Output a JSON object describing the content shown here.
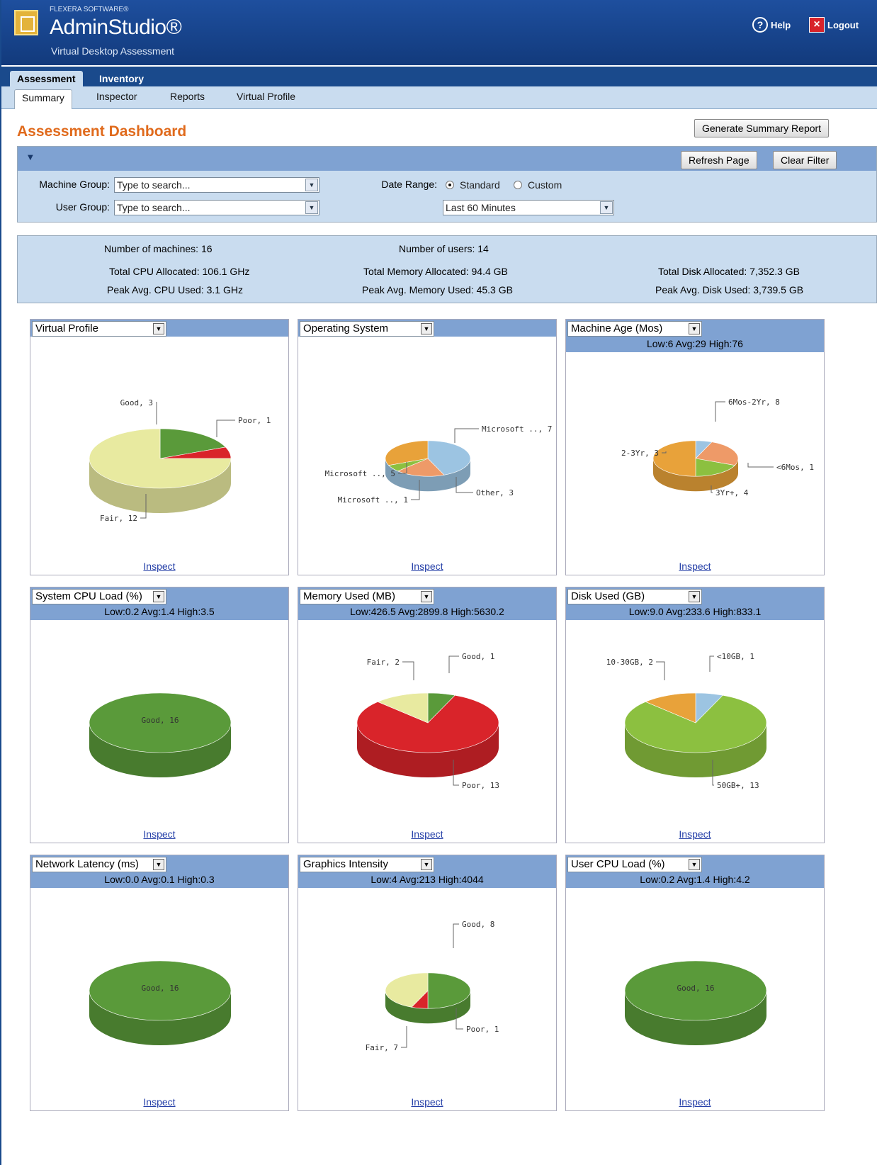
{
  "header": {
    "vendor": "FLEXERA SOFTWARE®",
    "product": "AdminStudio®",
    "subtitle": "Virtual Desktop Assessment",
    "help_label": "Help",
    "logout_label": "Logout"
  },
  "tabs": [
    {
      "label": "Assessment"
    },
    {
      "label": "Inventory"
    }
  ],
  "subtabs": [
    {
      "label": "Summary"
    },
    {
      "label": "Inspector"
    },
    {
      "label": "Reports"
    },
    {
      "label": "Virtual Profile"
    }
  ],
  "page": {
    "title": "Assessment Dashboard",
    "generate_button": "Generate Summary Report"
  },
  "filter": {
    "refresh_button": "Refresh Page",
    "clear_button": "Clear Filter",
    "machine_group_label": "Machine Group:",
    "machine_group_value": "Type to search...",
    "user_group_label": "User Group:",
    "user_group_value": "Type to search...",
    "date_range_label": "Date Range:",
    "standard_label": "Standard",
    "custom_label": "Custom",
    "date_range_value": "Last 60 Minutes"
  },
  "stats": {
    "machines": "Number of machines: 16",
    "users": "Number of users: 14",
    "cpu_alloc": "Total CPU Allocated: 106.1 GHz",
    "mem_alloc": "Total Memory Allocated: 94.4 GB",
    "disk_alloc": "Total Disk Allocated: 7,352.3 GB",
    "cpu_used": "Peak Avg. CPU Used: 3.1 GHz",
    "mem_used": "Peak Avg. Memory Used: 45.3 GB",
    "disk_used": "Peak Avg. Disk Used: 3,739.5 GB"
  },
  "colors": {
    "good": "#5a9a3a",
    "poor": "#d9242a",
    "fair": "#e8eaa0",
    "orange": "#e8a23a",
    "blue": "#9cc4e2",
    "salmon": "#ee9a68",
    "lightgreen": "#8cc040",
    "accent": "#e06a1c",
    "bar": "#7fa2d2"
  },
  "panels": [
    {
      "title": "Virtual Profile",
      "stats": "",
      "inspect": "Inspect"
    },
    {
      "title": "Operating System",
      "stats": "",
      "inspect": "Inspect"
    },
    {
      "title": "Machine Age (Mos)",
      "stats": "Low:6 Avg:29 High:76",
      "inspect": "Inspect"
    },
    {
      "title": "System CPU Load (%)",
      "stats": "Low:0.2 Avg:1.4 High:3.5",
      "inspect": "Inspect"
    },
    {
      "title": "Memory Used (MB)",
      "stats": "Low:426.5 Avg:2899.8 High:5630.2",
      "inspect": "Inspect"
    },
    {
      "title": "Disk Used (GB)",
      "stats": "Low:9.0 Avg:233.6 High:833.1",
      "inspect": "Inspect"
    },
    {
      "title": "Network Latency (ms)",
      "stats": "Low:0.0 Avg:0.1 High:0.3",
      "inspect": "Inspect"
    },
    {
      "title": "Graphics Intensity",
      "stats": "Low:4 Avg:213 High:4044",
      "inspect": "Inspect"
    },
    {
      "title": "User CPU Load (%)",
      "stats": "Low:0.2 Avg:1.4 High:4.2",
      "inspect": "Inspect"
    }
  ],
  "chart_data": [
    {
      "type": "pie",
      "title": "Virtual Profile",
      "categories": [
        "Good",
        "Poor",
        "Fair"
      ],
      "values": [
        3,
        1,
        12
      ],
      "labels": [
        "Good, 3",
        "Poor, 1",
        "Fair, 12"
      ],
      "colors": [
        "#5a9a3a",
        "#d9242a",
        "#e8eaa0"
      ]
    },
    {
      "type": "pie",
      "title": "Operating System",
      "categories": [
        "Microsoft ..",
        "Other",
        "Microsoft ..",
        "Microsoft .."
      ],
      "values": [
        7,
        3,
        1,
        5
      ],
      "labels": [
        "Microsoft .., 7",
        "Other, 3",
        "Microsoft .., 1",
        "Microsoft .., 5"
      ],
      "colors": [
        "#9cc4e2",
        "#ee9a68",
        "#8cc040",
        "#e8a23a"
      ]
    },
    {
      "type": "pie",
      "title": "Machine Age (Mos)",
      "categories": [
        "<6Mos",
        "3Yr+",
        "2-3Yr",
        "6Mos-2Yr"
      ],
      "values": [
        1,
        4,
        3,
        8
      ],
      "labels": [
        "<6Mos, 1",
        "3Yr+, 4",
        "2-3Yr, 3",
        "6Mos-2Yr, 8"
      ],
      "colors": [
        "#9cc4e2",
        "#ee9a68",
        "#8cc040",
        "#e8a23a"
      ]
    },
    {
      "type": "pie",
      "title": "System CPU Load (%)",
      "categories": [
        "Good"
      ],
      "values": [
        16
      ],
      "labels": [
        "Good, 16"
      ],
      "colors": [
        "#5a9a3a"
      ]
    },
    {
      "type": "pie",
      "title": "Memory Used (MB)",
      "categories": [
        "Good",
        "Poor",
        "Fair"
      ],
      "values": [
        1,
        13,
        2
      ],
      "labels": [
        "Good, 1",
        "Poor, 13",
        "Fair, 2"
      ],
      "colors": [
        "#5a9a3a",
        "#d9242a",
        "#e8eaa0"
      ]
    },
    {
      "type": "pie",
      "title": "Disk Used (GB)",
      "categories": [
        "<10GB",
        "50GB+",
        "10-30GB"
      ],
      "values": [
        1,
        13,
        2
      ],
      "labels": [
        "<10GB, 1",
        "50GB+, 13",
        "10-30GB, 2"
      ],
      "colors": [
        "#9cc4e2",
        "#8cc040",
        "#e8a23a"
      ]
    },
    {
      "type": "pie",
      "title": "Network Latency (ms)",
      "categories": [
        "Good"
      ],
      "values": [
        16
      ],
      "labels": [
        "Good, 16"
      ],
      "colors": [
        "#5a9a3a"
      ]
    },
    {
      "type": "pie",
      "title": "Graphics Intensity",
      "categories": [
        "Good",
        "Poor",
        "Fair"
      ],
      "values": [
        8,
        1,
        7
      ],
      "labels": [
        "Good, 8",
        "Poor, 1",
        "Fair, 7"
      ],
      "colors": [
        "#5a9a3a",
        "#d9242a",
        "#e8eaa0"
      ]
    },
    {
      "type": "pie",
      "title": "User CPU Load (%)",
      "categories": [
        "Good"
      ],
      "values": [
        16
      ],
      "labels": [
        "Good, 16"
      ],
      "colors": [
        "#5a9a3a"
      ]
    }
  ]
}
